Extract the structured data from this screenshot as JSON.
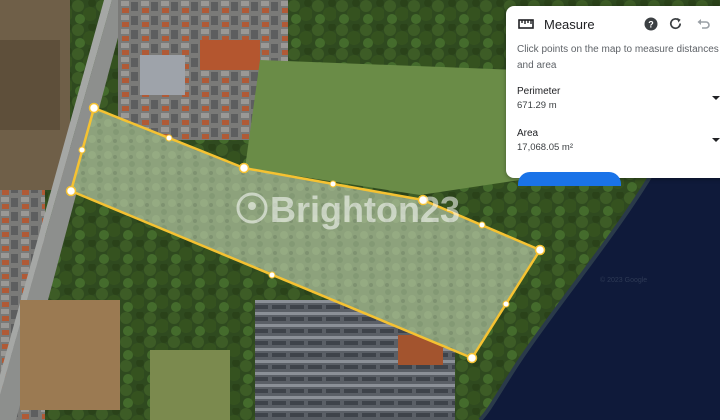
{
  "map": {
    "watermark": "Brighton23",
    "imagery_credit": "© 2023 Google",
    "colors": {
      "polygon_stroke": "#f5c232",
      "polygon_fill": "rgba(225,225,225,0.28)",
      "vertex_fill": "#ffffff",
      "sea": "#0f1a3a",
      "vegetation": "#4a6a2e"
    }
  },
  "panel": {
    "title": "Measure",
    "icons": [
      "ruler-icon",
      "help-icon",
      "reset-icon",
      "undo-icon"
    ],
    "instruction": "Click points on the map to measure distances and area",
    "perimeter_label": "Perimeter",
    "perimeter_value": "671.29 m",
    "area_label": "Area",
    "area_value": "17,068.05 m²",
    "accent": "#1a73e8"
  }
}
